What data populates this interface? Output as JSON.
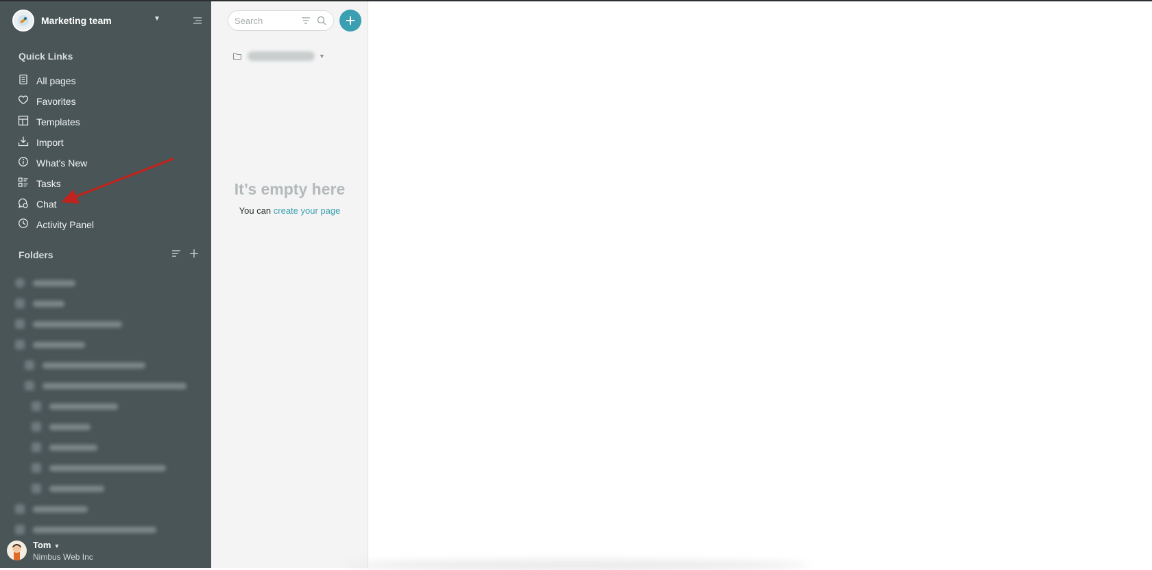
{
  "workspace": {
    "name": "Marketing team"
  },
  "sidebar": {
    "quick_links_title": "Quick Links",
    "links": [
      {
        "label": "All pages",
        "icon": "page-icon"
      },
      {
        "label": "Favorites",
        "icon": "heart-icon"
      },
      {
        "label": "Templates",
        "icon": "templates-icon"
      },
      {
        "label": "Import",
        "icon": "import-icon"
      },
      {
        "label": "What's New",
        "icon": "info-icon"
      },
      {
        "label": "Tasks",
        "icon": "tasks-icon"
      },
      {
        "label": "Chat",
        "icon": "chat-icon"
      },
      {
        "label": "Activity Panel",
        "icon": "clock-icon"
      }
    ],
    "folders_title": "Folders"
  },
  "user": {
    "name": "Tom",
    "org": "Nimbus Web Inc"
  },
  "middle": {
    "search_placeholder": "Search",
    "empty_title": "It’s empty here",
    "empty_prefix": "You can ",
    "empty_link": "create your page"
  },
  "colors": {
    "sidebar_bg": "#495557",
    "accent": "#3a9fb1",
    "annotation_arrow": "#c0231b"
  }
}
